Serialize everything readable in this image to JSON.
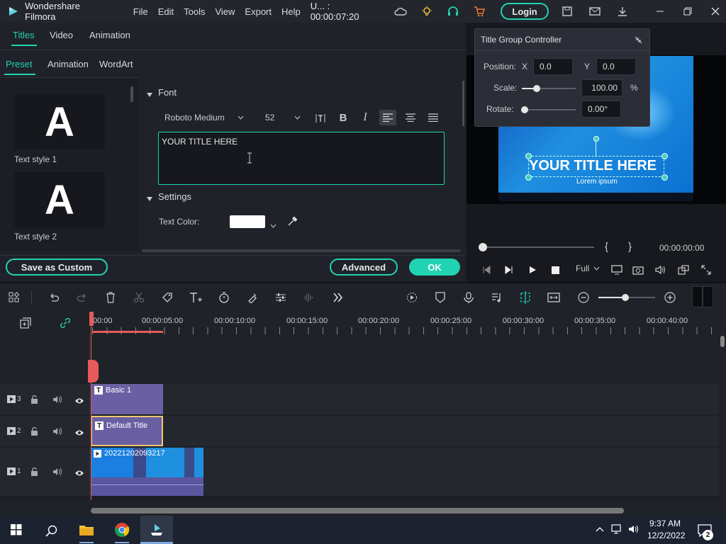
{
  "app": {
    "title": "Wondershare Filmora",
    "menus": [
      "File",
      "Edit",
      "Tools",
      "View",
      "Export",
      "Help"
    ],
    "project_status": "U... : 00:00:07:20",
    "login_label": "Login"
  },
  "left": {
    "tabs": [
      "Titles",
      "Video",
      "Animation"
    ],
    "subtabs": [
      "Preset",
      "Animation",
      "WordArt"
    ],
    "styles": [
      {
        "letter": "A",
        "label": "Text style 1"
      },
      {
        "letter": "A",
        "label": "Text style 2"
      }
    ],
    "font_section": "Font",
    "font_name": "Roboto Medium",
    "font_size": "52",
    "text_value": "YOUR TITLE HERE",
    "settings_section": "Settings",
    "text_color_label": "Text Color:",
    "text_color": "#ffffff",
    "save_custom": "Save as Custom",
    "advanced": "Advanced",
    "ok": "OK"
  },
  "controller": {
    "title": "Title Group Controller",
    "position_label": "Position:",
    "x_label": "X",
    "x_value": "0.0",
    "y_label": "Y",
    "y_value": "0.0",
    "scale_label": "Scale:",
    "scale_value": "100.00",
    "scale_unit": "%",
    "rotate_label": "Rotate:",
    "rotate_value": "0.00°",
    "scale_level": 0.25,
    "rotate_level": 0.0
  },
  "preview": {
    "overlay_title": "YOUR TITLE HERE",
    "overlay_sub": "Lorem ipsum",
    "timecode": "00:00:00:00",
    "bracket_open": "{",
    "bracket_close": "}",
    "quality": "Full"
  },
  "timeline": {
    "ruler": [
      "00:00",
      "00:00:05:00",
      "00:00:10:00",
      "00:00:15:00",
      "00:00:20:00",
      "00:00:25:00",
      "00:00:30:00",
      "00:00:35:00",
      "00:00:40:00"
    ],
    "tracks": [
      {
        "num": "3",
        "clip": "Basic 1"
      },
      {
        "num": "2",
        "clip": "Default Title"
      },
      {
        "num": "1",
        "clip": "20221202093217"
      }
    ]
  },
  "taskbar": {
    "time": "9:37 AM",
    "date": "12/2/2022",
    "notifications": "2"
  },
  "colors": {
    "accent": "#22d3b3",
    "clip_title": "#6b5fa3",
    "clip_selected_border": "#f0c674",
    "playhead": "#e85a5a",
    "preview_blue": "#1f8fe0"
  }
}
